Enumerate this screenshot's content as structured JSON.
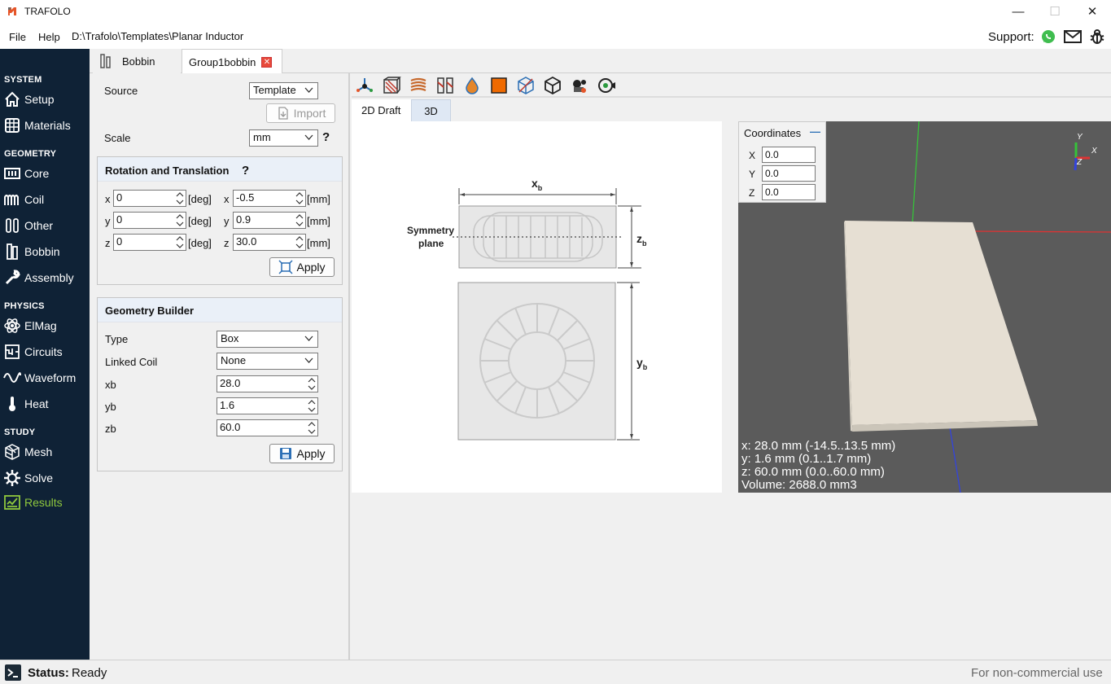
{
  "window": {
    "title": "TRAFOLO",
    "minimize": "—",
    "maximize": "☐",
    "close": "✕"
  },
  "menu": {
    "file": "File",
    "help": "Help",
    "path": "D:\\Trafolo\\Templates\\Planar Inductor",
    "support": "Support:"
  },
  "sidebar": {
    "system": "SYSTEM",
    "setup": "Setup",
    "materials": "Materials",
    "geometry": "GEOMETRY",
    "core": "Core",
    "coil": "Coil",
    "other": "Other",
    "bobbin": "Bobbin",
    "assembly": "Assembly",
    "physics": "PHYSICS",
    "elmag": "ElMag",
    "circuits": "Circuits",
    "waveform": "Waveform",
    "heat": "Heat",
    "study": "STUDY",
    "mesh": "Mesh",
    "solve": "Solve",
    "results": "Results"
  },
  "tabs": {
    "bobbin": "Bobbin",
    "group": "Group1bobbin",
    "close": "✕"
  },
  "source": {
    "label": "Source",
    "value": "Template",
    "import": "Import"
  },
  "scale": {
    "label": "Scale",
    "value": "mm",
    "help": "?"
  },
  "rotation": {
    "title": "Rotation and Translation",
    "help": "?",
    "rx_label": "x",
    "rx": "0",
    "ry_label": "y",
    "ry": "0",
    "rz_label": "z",
    "rz": "0",
    "deg": "[deg]",
    "tx_label": "x",
    "tx": "-0.5",
    "ty_label": "y",
    "ty": "0.9",
    "tz_label": "z",
    "tz": "30.0",
    "mm": "[mm]",
    "apply": "Apply"
  },
  "builder": {
    "title": "Geometry Builder",
    "type_label": "Type",
    "type": "Box",
    "linked_label": "Linked Coil",
    "linked": "None",
    "xb_label": "xb",
    "xb": "28.0",
    "yb_label": "yb",
    "yb": "1.6",
    "zb_label": "zb",
    "zb": "60.0",
    "apply": "Apply"
  },
  "viewtabs": {
    "draft": "2D Draft",
    "three": "3D"
  },
  "draft": {
    "sym1": "Symmetry",
    "sym2": "plane",
    "x": "x",
    "y": "y",
    "z": "z",
    "sub": "b"
  },
  "coords": {
    "title": "Coordinates",
    "minus": "—",
    "x_label": "X",
    "x": "0.0",
    "y_label": "Y",
    "y": "0.0",
    "z_label": "Z",
    "z": "0.0"
  },
  "axes": {
    "y": "Y",
    "x": "X",
    "z": "Z"
  },
  "info3d": {
    "x": "x: 28.0 mm (-14.5..13.5 mm)",
    "y": "y: 1.6 mm (0.1..1.7 mm)",
    "z": "z: 60.0 mm (0.0..60.0 mm)",
    "vol": "Volume: 2688.0 mm3"
  },
  "status": {
    "label": "Status:",
    "value": "Ready",
    "right": "For non-commercial use"
  }
}
